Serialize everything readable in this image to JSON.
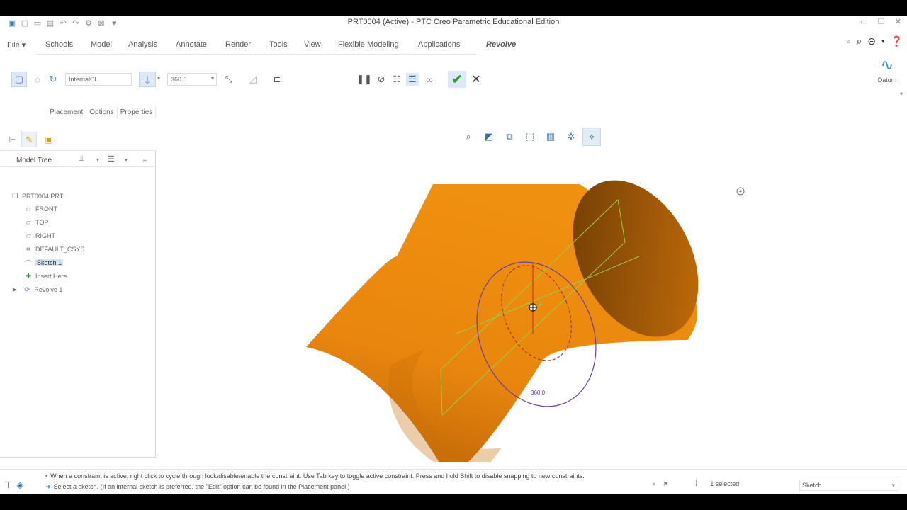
{
  "window": {
    "title": "PRT0004 (Active) - PTC Creo Parametric Educational Edition"
  },
  "menu": {
    "items": [
      "File ▾",
      "Schools",
      "Model",
      "Analysis",
      "Annotate",
      "Render",
      "Tools",
      "View",
      "Flexible Modeling",
      "Applications",
      "Revolve"
    ]
  },
  "ribbon": {
    "axis_field": "InternalCL",
    "angle_field": "360.0",
    "datum_label": "Datum"
  },
  "subtabs": [
    "Placement",
    "Options",
    "Properties"
  ],
  "model_tree": {
    "title": "Model Tree",
    "items": [
      {
        "label": "PRT0004.PRT",
        "icon": "part-icon"
      },
      {
        "label": "FRONT",
        "icon": "datum-plane-icon"
      },
      {
        "label": "TOP",
        "icon": "datum-plane-icon"
      },
      {
        "label": "RIGHT",
        "icon": "datum-plane-icon"
      },
      {
        "label": "DEFAULT_CSYS",
        "icon": "csys-icon"
      },
      {
        "label": "Sketch 1",
        "icon": "sketch-icon"
      },
      {
        "label": "Insert Here",
        "icon": "insert-arrow-icon"
      },
      {
        "label": "Revolve 1",
        "icon": "revolve-icon"
      }
    ]
  },
  "viewport": {
    "dimension_label": "360.0",
    "body_color": "#e8860e",
    "sketch_color": "#6a3d9a",
    "datum_color": "#9bcf4a"
  },
  "status": {
    "message1": "When a constraint is active, right click to cycle through lock/disable/enable the constraint. Use Tab key to toggle active constraint. Press and hold Shift to disable snapping to new constraints.",
    "message2": "Select a sketch. (If an internal sketch is preferred, the \"Edit\" option can be found in the Placement panel.)",
    "selection_count": "1 selected",
    "filter": "Sketch"
  }
}
